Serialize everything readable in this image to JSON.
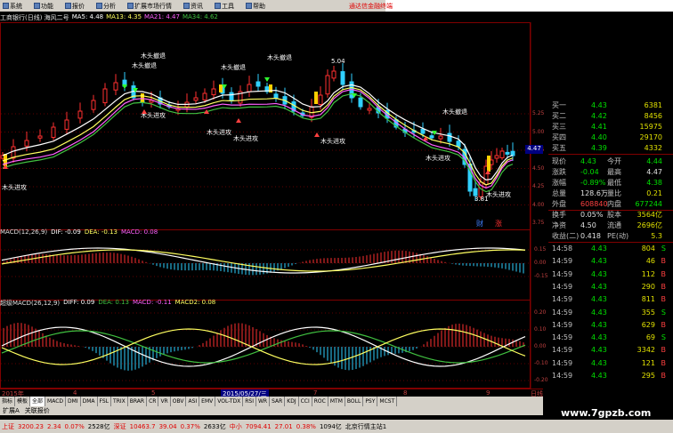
{
  "menu": [
    {
      "label": "系统",
      "icon": "system-icon"
    },
    {
      "label": "功能",
      "icon": "function-icon"
    },
    {
      "label": "报价",
      "icon": "quote-icon"
    },
    {
      "label": "分析",
      "icon": "analysis-icon"
    },
    {
      "label": "扩展市场行情",
      "icon": "market-icon"
    },
    {
      "label": "资讯",
      "icon": "news-icon"
    },
    {
      "label": "工具",
      "icon": "tools-icon"
    },
    {
      "label": "帮助",
      "icon": "help-icon"
    }
  ],
  "promo": "通达信金融终端",
  "header": {
    "title": "工商银行(日线) 海风二号",
    "ma5": "MA5: 4.48",
    "ma13": "MA13: 4.35",
    "ma21": "MA21: 4.47",
    "ma34": "MA34: 4.62"
  },
  "annotations": {
    "top": "木头撤退",
    "bottom": "木头进攻",
    "high": "5.04",
    "low": "3.81",
    "cai": "财",
    "yang": "涨"
  },
  "price_axis": [
    "5.25",
    "5.00",
    "4.75",
    "4.50",
    "4.25",
    "4.00",
    "3.75"
  ],
  "current_price_tag": "4.47",
  "macd": {
    "label": "MACD(12,26,9)",
    "dif": "DIF: -0.09",
    "dea": "DEA: -0.13",
    "macd": "MACD: 0.08",
    "axis": [
      "0.15",
      "0.00",
      "-0.15"
    ]
  },
  "super_macd": {
    "label": "超级MACD(26,12,9)",
    "diff": "DIFF: 0.09",
    "dea": "DEA: 0.13",
    "macd": "MACD: -0.11",
    "macd2": "MACD2: 0.08",
    "axis": [
      "0.20",
      "0.10",
      "0.00",
      "-0.10",
      "-0.20"
    ]
  },
  "time_axis": [
    "2015年",
    "4",
    "5",
    "2015/05/27/三",
    "7",
    "8",
    "9",
    "日线"
  ],
  "quote": {
    "order_book": [
      {
        "label": "买一",
        "price": "4.43",
        "vol": "6381"
      },
      {
        "label": "买二",
        "price": "4.42",
        "vol": "8456"
      },
      {
        "label": "买三",
        "price": "4.41",
        "vol": "15975"
      },
      {
        "label": "买四",
        "price": "4.40",
        "vol": "29170"
      },
      {
        "label": "买五",
        "price": "4.39",
        "vol": "4332"
      }
    ],
    "stats": [
      {
        "l1": "现价",
        "v1": "4.43",
        "l2": "今开",
        "v2": "4.44"
      },
      {
        "l1": "涨跌",
        "v1": "-0.04",
        "l2": "最高",
        "v2": "4.47"
      },
      {
        "l1": "涨幅",
        "v1": "-0.89%",
        "l2": "最低",
        "v2": "4.38"
      },
      {
        "l1": "总量",
        "v1": "128.6万",
        "l2": "量比",
        "v2": "0.21"
      },
      {
        "l1": "外盘",
        "v1": "608840",
        "l2": "内盘",
        "v2": "677244"
      },
      {
        "l1": "换手",
        "v1": "0.05%",
        "l2": "股本",
        "v2": "3564亿"
      },
      {
        "l1": "净资",
        "v1": "4.50",
        "l2": "流通",
        "v2": "2696亿"
      },
      {
        "l1": "收益(二)",
        "v1": "0.418",
        "l2": "PE(动)",
        "v2": "5.3"
      }
    ],
    "ticks": [
      {
        "t": "14:58",
        "p": "4.43",
        "v": "804",
        "bs": "S"
      },
      {
        "t": "14:59",
        "p": "4.43",
        "v": "46",
        "bs": "B"
      },
      {
        "t": "14:59",
        "p": "4.43",
        "v": "112",
        "bs": "B"
      },
      {
        "t": "14:59",
        "p": "4.43",
        "v": "290",
        "bs": "B"
      },
      {
        "t": "14:59",
        "p": "4.43",
        "v": "811",
        "bs": "B"
      },
      {
        "t": "14:59",
        "p": "4.43",
        "v": "355",
        "bs": "S"
      },
      {
        "t": "14:59",
        "p": "4.43",
        "v": "629",
        "bs": "B"
      },
      {
        "t": "14:59",
        "p": "4.43",
        "v": "69",
        "bs": "S"
      },
      {
        "t": "14:59",
        "p": "4.43",
        "v": "3342",
        "bs": "B"
      },
      {
        "t": "14:59",
        "p": "4.43",
        "v": "121",
        "bs": "B"
      },
      {
        "t": "14:59",
        "p": "4.43",
        "v": "295",
        "bs": "B"
      }
    ]
  },
  "tabs": [
    "指标",
    "模板",
    "全部",
    "MACD",
    "DMI",
    "DMA",
    "FSL",
    "TRIX",
    "BRAR",
    "CR",
    "VR",
    "OBV",
    "ASI",
    "EMV",
    "VOL-TDX",
    "RSI",
    "WR",
    "SAR",
    "KDJ",
    "CCI",
    "ROC",
    "MTM",
    "BOLL",
    "PSY",
    "MCST"
  ],
  "tabs2": [
    "扩展A",
    "关联报价"
  ],
  "status": {
    "sh_label": "上证",
    "sh_val": "3200.23",
    "sh_chg": "2.34",
    "sh_pct": "0.07%",
    "sh_amt": "2528亿",
    "sz_label": "深证",
    "sz_val": "10463.7",
    "sz_chg": "39.04",
    "sz_pct": "0.37%",
    "sz_amt": "2633亿",
    "zx_label": "中小",
    "zx_val": "7094.41",
    "zx_chg": "27.01",
    "zx_pct": "0.38%",
    "zx_amt": "1094亿",
    "server": "北京行情主站1"
  },
  "watermark": "www.7gpzb.com",
  "colors": {
    "up": "#ff3030",
    "down": "#30d0ff",
    "ma_white": "#ffffff",
    "ma_yellow": "#ffff60",
    "ma_green": "#40c040",
    "ma_magenta": "#ff60ff"
  }
}
